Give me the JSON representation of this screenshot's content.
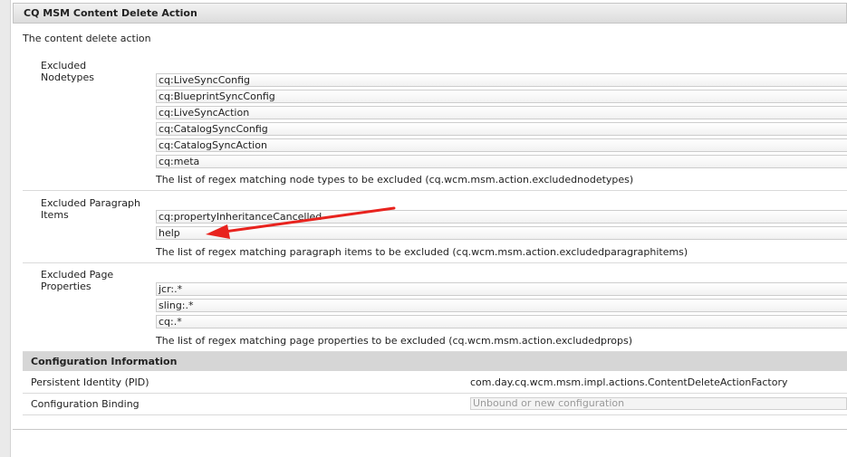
{
  "section": {
    "title": "CQ MSM Content Delete Action",
    "description": "The content delete action"
  },
  "properties": [
    {
      "label": "Excluded Nodetypes",
      "values": [
        "cq:LiveSyncConfig",
        "cq:BlueprintSyncConfig",
        "cq:LiveSyncAction",
        "cq:CatalogSyncConfig",
        "cq:CatalogSyncAction",
        "cq:meta"
      ],
      "hint": "The list of regex matching node types to be excluded (cq.wcm.msm.action.excludednodetypes)"
    },
    {
      "label": "Excluded Paragraph Items",
      "values": [
        "cq:propertyInheritanceCancelled",
        "help"
      ],
      "hint": "The list of regex matching paragraph items to be excluded (cq.wcm.msm.action.excludedparagraphitems)"
    },
    {
      "label": "Excluded Page Properties",
      "values": [
        "jcr:.*",
        "sling:.*",
        "cq:.*"
      ],
      "hint": "The list of regex matching page properties to be excluded (cq.wcm.msm.action.excludedprops)"
    }
  ],
  "config": {
    "title": "Configuration Information",
    "pid_label": "Persistent Identity (PID)",
    "pid_value": "com.day.cq.wcm.msm.impl.actions.ContentDeleteActionFactory",
    "binding_label": "Configuration Binding",
    "binding_placeholder": "Unbound or new configuration"
  },
  "colors": {
    "annotation_arrow": "#e8231e"
  },
  "icons": [
    "arrow-annotation-icon"
  ]
}
